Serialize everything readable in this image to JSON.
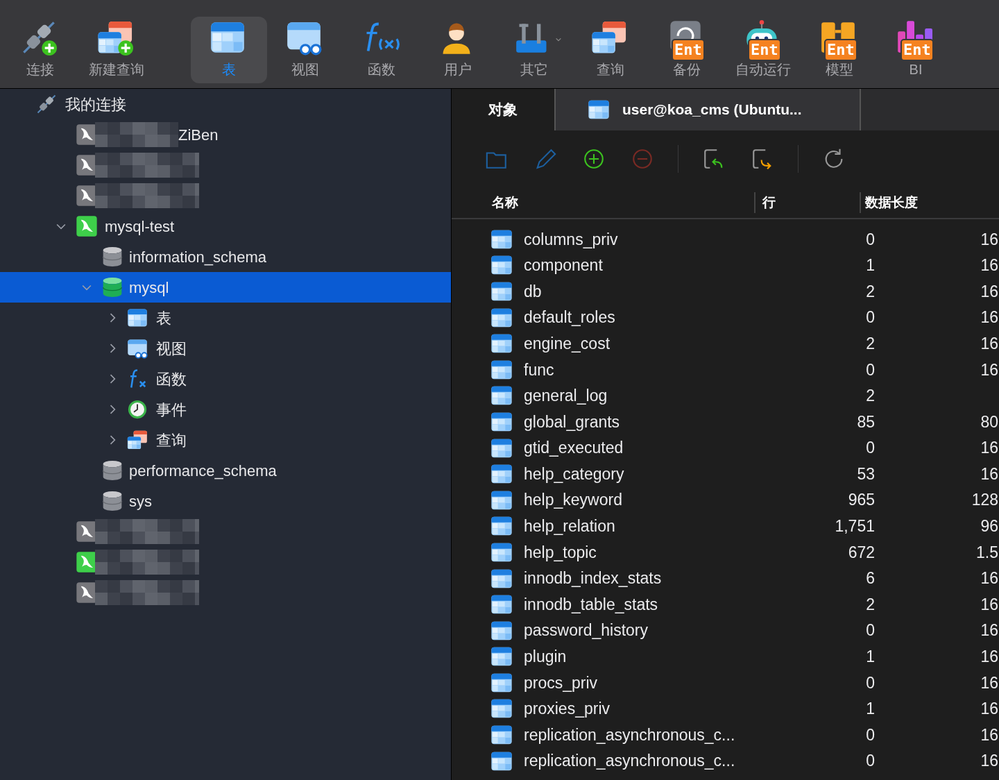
{
  "toolbar": [
    {
      "kind": "connect",
      "label": "连接",
      "selected": false
    },
    {
      "kind": "new-query",
      "label": "新建查询",
      "selected": false
    },
    {
      "kind": "table",
      "label": "表",
      "selected": true
    },
    {
      "kind": "view",
      "label": "视图",
      "selected": false
    },
    {
      "kind": "function",
      "label": "函数",
      "selected": false
    },
    {
      "kind": "user",
      "label": "用户",
      "selected": false
    },
    {
      "kind": "tools",
      "label": "其它",
      "selected": false
    },
    {
      "kind": "query",
      "label": "查询",
      "selected": false
    },
    {
      "kind": "backup",
      "label": "备份",
      "badge": "Ent",
      "selected": false
    },
    {
      "kind": "robot",
      "label": "自动运行",
      "badge": "Ent",
      "selected": false
    },
    {
      "kind": "model",
      "label": "模型",
      "badge": "Ent",
      "selected": false
    },
    {
      "kind": "bi",
      "label": "BI",
      "badge": "Ent",
      "selected": false
    }
  ],
  "sidebar": {
    "group": {
      "label": "我的连接",
      "children": [
        {
          "kind": "redacted",
          "label": "ZiBen",
          "connected": false
        },
        {
          "kind": "redacted",
          "connected": false
        },
        {
          "kind": "redacted",
          "connected": false
        },
        {
          "kind": "connection",
          "label": "mysql-test",
          "connected": true,
          "expanded": true,
          "children": [
            {
              "kind": "database",
              "label": "information_schema",
              "selected": false
            },
            {
              "kind": "database",
              "label": "mysql",
              "selected": true,
              "expanded": true,
              "children": [
                {
                  "kind": "tables",
                  "label": "表",
                  "expanded": false
                },
                {
                  "kind": "views",
                  "label": "视图",
                  "expanded": false
                },
                {
                  "kind": "functions",
                  "label": "函数",
                  "expanded": false
                },
                {
                  "kind": "events",
                  "label": "事件",
                  "expanded": false
                },
                {
                  "kind": "queries",
                  "label": "查询",
                  "expanded": false
                }
              ]
            },
            {
              "kind": "database",
              "label": "performance_schema",
              "selected": false
            },
            {
              "kind": "database",
              "label": "sys",
              "selected": false
            }
          ]
        },
        {
          "kind": "redacted",
          "connected": false
        },
        {
          "kind": "redacted",
          "connected": true
        },
        {
          "kind": "redacted",
          "connected": false
        }
      ]
    }
  },
  "tabs": [
    {
      "label": "对象",
      "selected": true
    },
    {
      "label": "user@koa_cms (Ubuntu...",
      "selected": false
    }
  ],
  "table": {
    "columns": [
      "名称",
      "行",
      "数据长度"
    ],
    "rows": [
      {
        "name": "columns_priv",
        "rows": "0",
        "data_length": "16"
      },
      {
        "name": "component",
        "rows": "1",
        "data_length": "16"
      },
      {
        "name": "db",
        "rows": "2",
        "data_length": "16"
      },
      {
        "name": "default_roles",
        "rows": "0",
        "data_length": "16"
      },
      {
        "name": "engine_cost",
        "rows": "2",
        "data_length": "16"
      },
      {
        "name": "func",
        "rows": "0",
        "data_length": "16"
      },
      {
        "name": "general_log",
        "rows": "2"
      },
      {
        "name": "global_grants",
        "rows": "85",
        "data_length": "80"
      },
      {
        "name": "gtid_executed",
        "rows": "0",
        "data_length": "16"
      },
      {
        "name": "help_category",
        "rows": "53",
        "data_length": "16"
      },
      {
        "name": "help_keyword",
        "rows": "965",
        "data_length": "128"
      },
      {
        "name": "help_relation",
        "rows": "1,751",
        "data_length": "96"
      },
      {
        "name": "help_topic",
        "rows": "672",
        "data_length": "1.5"
      },
      {
        "name": "innodb_index_stats",
        "rows": "6",
        "data_length": "16"
      },
      {
        "name": "innodb_table_stats",
        "rows": "2",
        "data_length": "16"
      },
      {
        "name": "password_history",
        "rows": "0",
        "data_length": "16"
      },
      {
        "name": "plugin",
        "rows": "1",
        "data_length": "16"
      },
      {
        "name": "procs_priv",
        "rows": "0",
        "data_length": "16"
      },
      {
        "name": "proxies_priv",
        "rows": "1",
        "data_length": "16"
      },
      {
        "name": "replication_asynchronous_c...",
        "rows": "0",
        "data_length": "16"
      },
      {
        "name": "replication_asynchronous_c...",
        "rows": "0",
        "data_length": "16"
      }
    ]
  }
}
